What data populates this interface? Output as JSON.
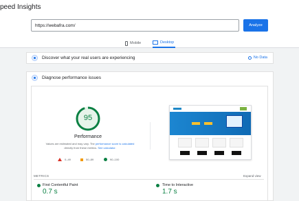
{
  "header": {
    "title": "peed Insights"
  },
  "search": {
    "url_value": "https://webafra.com/",
    "analyze_label": "Analyze"
  },
  "tabs": {
    "mobile_label": "Mobile",
    "desktop_label": "Desktop",
    "selected": "Desktop"
  },
  "field_data": {
    "title": "Discover what your real users are experiencing",
    "no_data_label": "No Data"
  },
  "diagnose": {
    "title": "Diagnose performance issues"
  },
  "score": {
    "value": "95",
    "fraction": 0.95,
    "label": "Performance",
    "disclaimer_prefix": "Values are estimated and may vary. The",
    "disclaimer_link1": "performance score is calculated",
    "disclaimer_mid": "directly from these metrics.",
    "disclaimer_link2": "See calculator."
  },
  "legend": [
    {
      "range": "0–49",
      "color": "#d93025"
    },
    {
      "range": "50–89",
      "color": "#f29900"
    },
    {
      "range": "90–100",
      "color": "#0b8043"
    }
  ],
  "metrics": {
    "section_label": "METRICS",
    "expand_label": "Expand view",
    "items": [
      {
        "name": "First Contentful Paint",
        "value": "0.7 s"
      },
      {
        "name": "Time to Interactive",
        "value": "1.7 s"
      }
    ]
  },
  "colors": {
    "accent": "#1a73e8",
    "good": "#0b8043"
  }
}
